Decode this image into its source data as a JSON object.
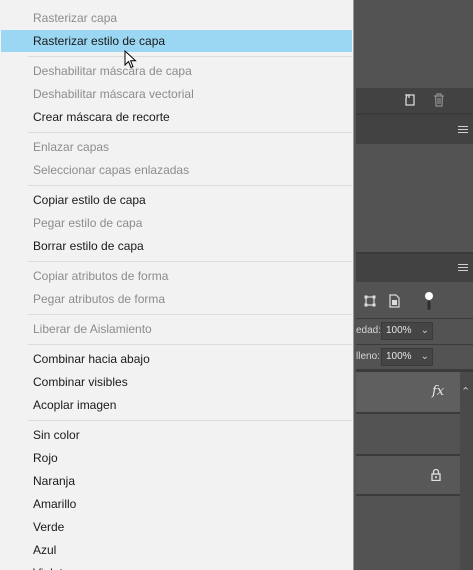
{
  "context_menu": {
    "items": [
      {
        "label": "Rasterizar capa",
        "enabled": false
      },
      {
        "label": "Rasterizar estilo de capa",
        "enabled": true,
        "highlighted": true
      },
      {
        "label": "Deshabilitar máscara de capa",
        "enabled": false
      },
      {
        "label": "Deshabilitar máscara vectorial",
        "enabled": false
      },
      {
        "label": "Crear máscara de recorte",
        "enabled": true
      },
      {
        "label": "Enlazar capas",
        "enabled": false
      },
      {
        "label": "Seleccionar capas enlazadas",
        "enabled": false
      },
      {
        "label": "Copiar estilo de capa",
        "enabled": true
      },
      {
        "label": "Pegar estilo de capa",
        "enabled": false
      },
      {
        "label": "Borrar estilo de capa",
        "enabled": true
      },
      {
        "label": "Copiar atributos de forma",
        "enabled": false
      },
      {
        "label": "Pegar atributos de forma",
        "enabled": false
      },
      {
        "label": "Liberar de Aislamiento",
        "enabled": false
      },
      {
        "label": "Combinar hacia abajo",
        "enabled": true
      },
      {
        "label": "Combinar visibles",
        "enabled": true
      },
      {
        "label": "Acoplar imagen",
        "enabled": true
      },
      {
        "label": "Sin color",
        "enabled": true
      },
      {
        "label": "Rojo",
        "enabled": true
      },
      {
        "label": "Naranja",
        "enabled": true
      },
      {
        "label": "Amarillo",
        "enabled": true
      },
      {
        "label": "Verde",
        "enabled": true
      },
      {
        "label": "Azul",
        "enabled": true
      },
      {
        "label": "Violeta",
        "enabled": true
      }
    ]
  },
  "layers_panel": {
    "opacity_label": "edad:",
    "opacity_value": "100%",
    "fill_label": "lleno:",
    "fill_value": "100%",
    "fx_label": "fx"
  },
  "colors": {
    "menu_bg": "#f2f2f2",
    "highlight": "#9bd6f3",
    "disabled_text": "#8c8c8c",
    "panel_bg": "#535353"
  }
}
